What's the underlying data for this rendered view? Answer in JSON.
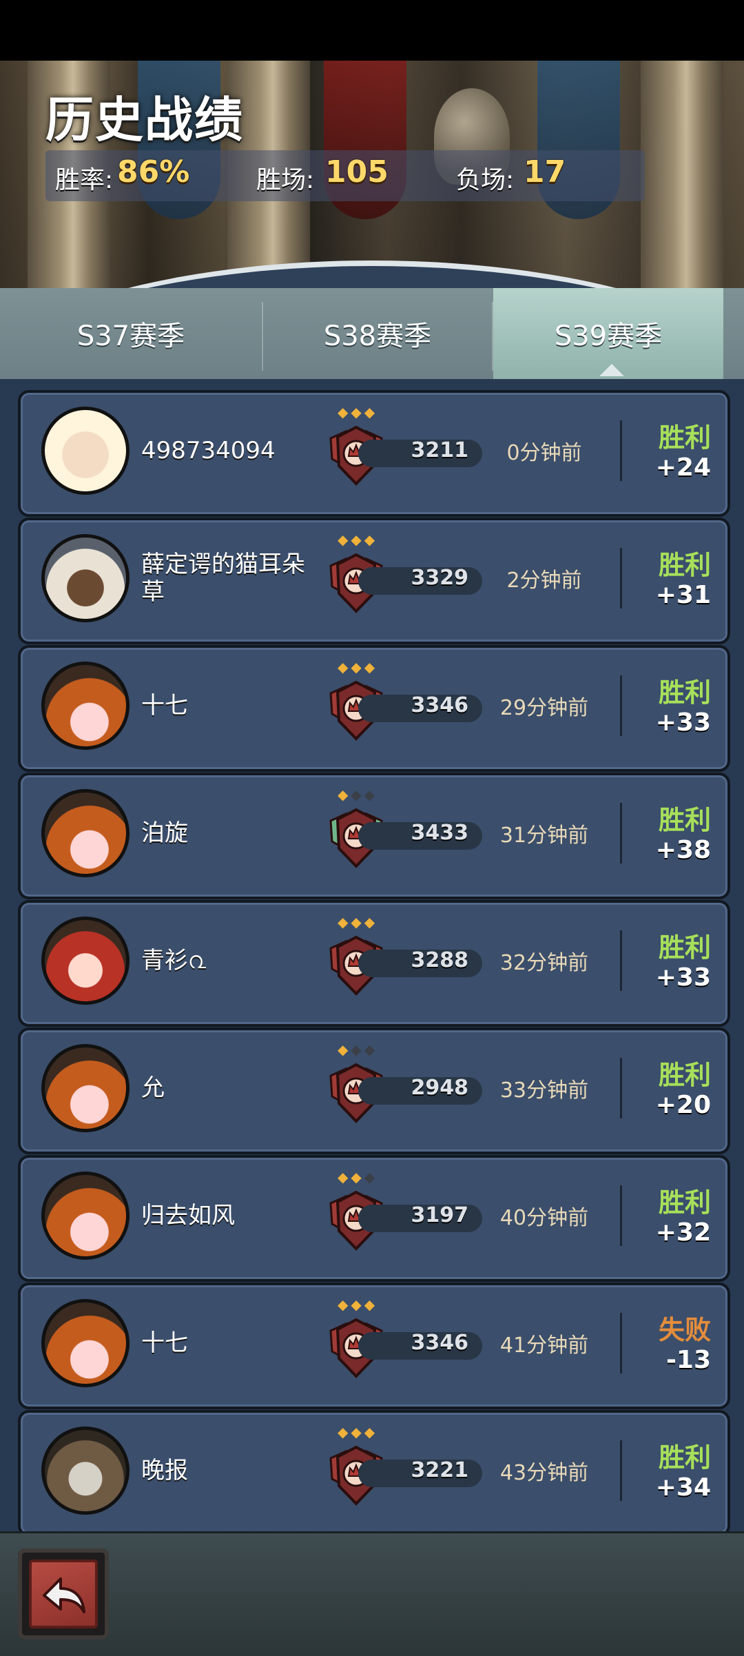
{
  "header": {
    "title": "历史战绩",
    "stats": {
      "win_rate_label": "胜率:",
      "win_rate_value": "86%",
      "wins_label": "胜场:",
      "wins_value": "105",
      "losses_label": "负场:",
      "losses_value": "17"
    }
  },
  "tabs": [
    {
      "label": "S37赛季",
      "active": false
    },
    {
      "label": "S38赛季",
      "active": false
    },
    {
      "label": "S39赛季",
      "active": true
    }
  ],
  "matches": [
    {
      "name": "498734094",
      "avatar": "lamb-avatar",
      "stars": 3,
      "stars_total": 3,
      "badge": "red-crown-badge",
      "score": "3211",
      "time": "0分钟前",
      "result": "胜利",
      "delta": "+24"
    },
    {
      "name": "薛定谔的猫耳朵草",
      "avatar": "cat-ear-girl-avatar",
      "stars": 3,
      "stars_total": 3,
      "badge": "red-crown-badge",
      "score": "3329",
      "time": "2分钟前",
      "result": "胜利",
      "delta": "+31"
    },
    {
      "name": "十七",
      "avatar": "pumpkin-avatar",
      "stars": 3,
      "stars_total": 3,
      "badge": "red-crown-badge",
      "score": "3346",
      "time": "29分钟前",
      "result": "胜利",
      "delta": "+33"
    },
    {
      "name": "泊旋",
      "avatar": "pumpkin-avatar",
      "stars": 1,
      "stars_total": 3,
      "badge": "winged-crown-badge",
      "score": "3433",
      "time": "31分钟前",
      "result": "胜利",
      "delta": "+38"
    },
    {
      "name": "青衫൨",
      "avatar": "chief-avatar",
      "stars": 3,
      "stars_total": 3,
      "badge": "red-crown-badge",
      "score": "3288",
      "time": "32分钟前",
      "result": "胜利",
      "delta": "+33"
    },
    {
      "name": "允",
      "avatar": "pumpkin-avatar",
      "stars": 1,
      "stars_total": 3,
      "badge": "red-crown-badge",
      "score": "2948",
      "time": "33分钟前",
      "result": "胜利",
      "delta": "+20"
    },
    {
      "name": "归去如风",
      "avatar": "pumpkin-avatar",
      "stars": 2,
      "stars_total": 3,
      "badge": "red-crown-badge",
      "score": "3197",
      "time": "40分钟前",
      "result": "胜利",
      "delta": "+32"
    },
    {
      "name": "十七",
      "avatar": "pumpkin-avatar",
      "stars": 3,
      "stars_total": 3,
      "badge": "red-crown-badge",
      "score": "3346",
      "time": "41分钟前",
      "result": "失败",
      "delta": "-13"
    },
    {
      "name": "晚报",
      "avatar": "monk-avatar",
      "stars": 3,
      "stars_total": 3,
      "badge": "red-crown-badge",
      "score": "3221",
      "time": "43分钟前",
      "result": "胜利",
      "delta": "+34"
    }
  ],
  "footer": {
    "back_icon": "back-arrow-icon"
  },
  "colors": {
    "win": "#a7e05a",
    "loss": "#e38d3c",
    "accent_gold": "#ffd86a",
    "card_bg": "#3b4e6b"
  }
}
